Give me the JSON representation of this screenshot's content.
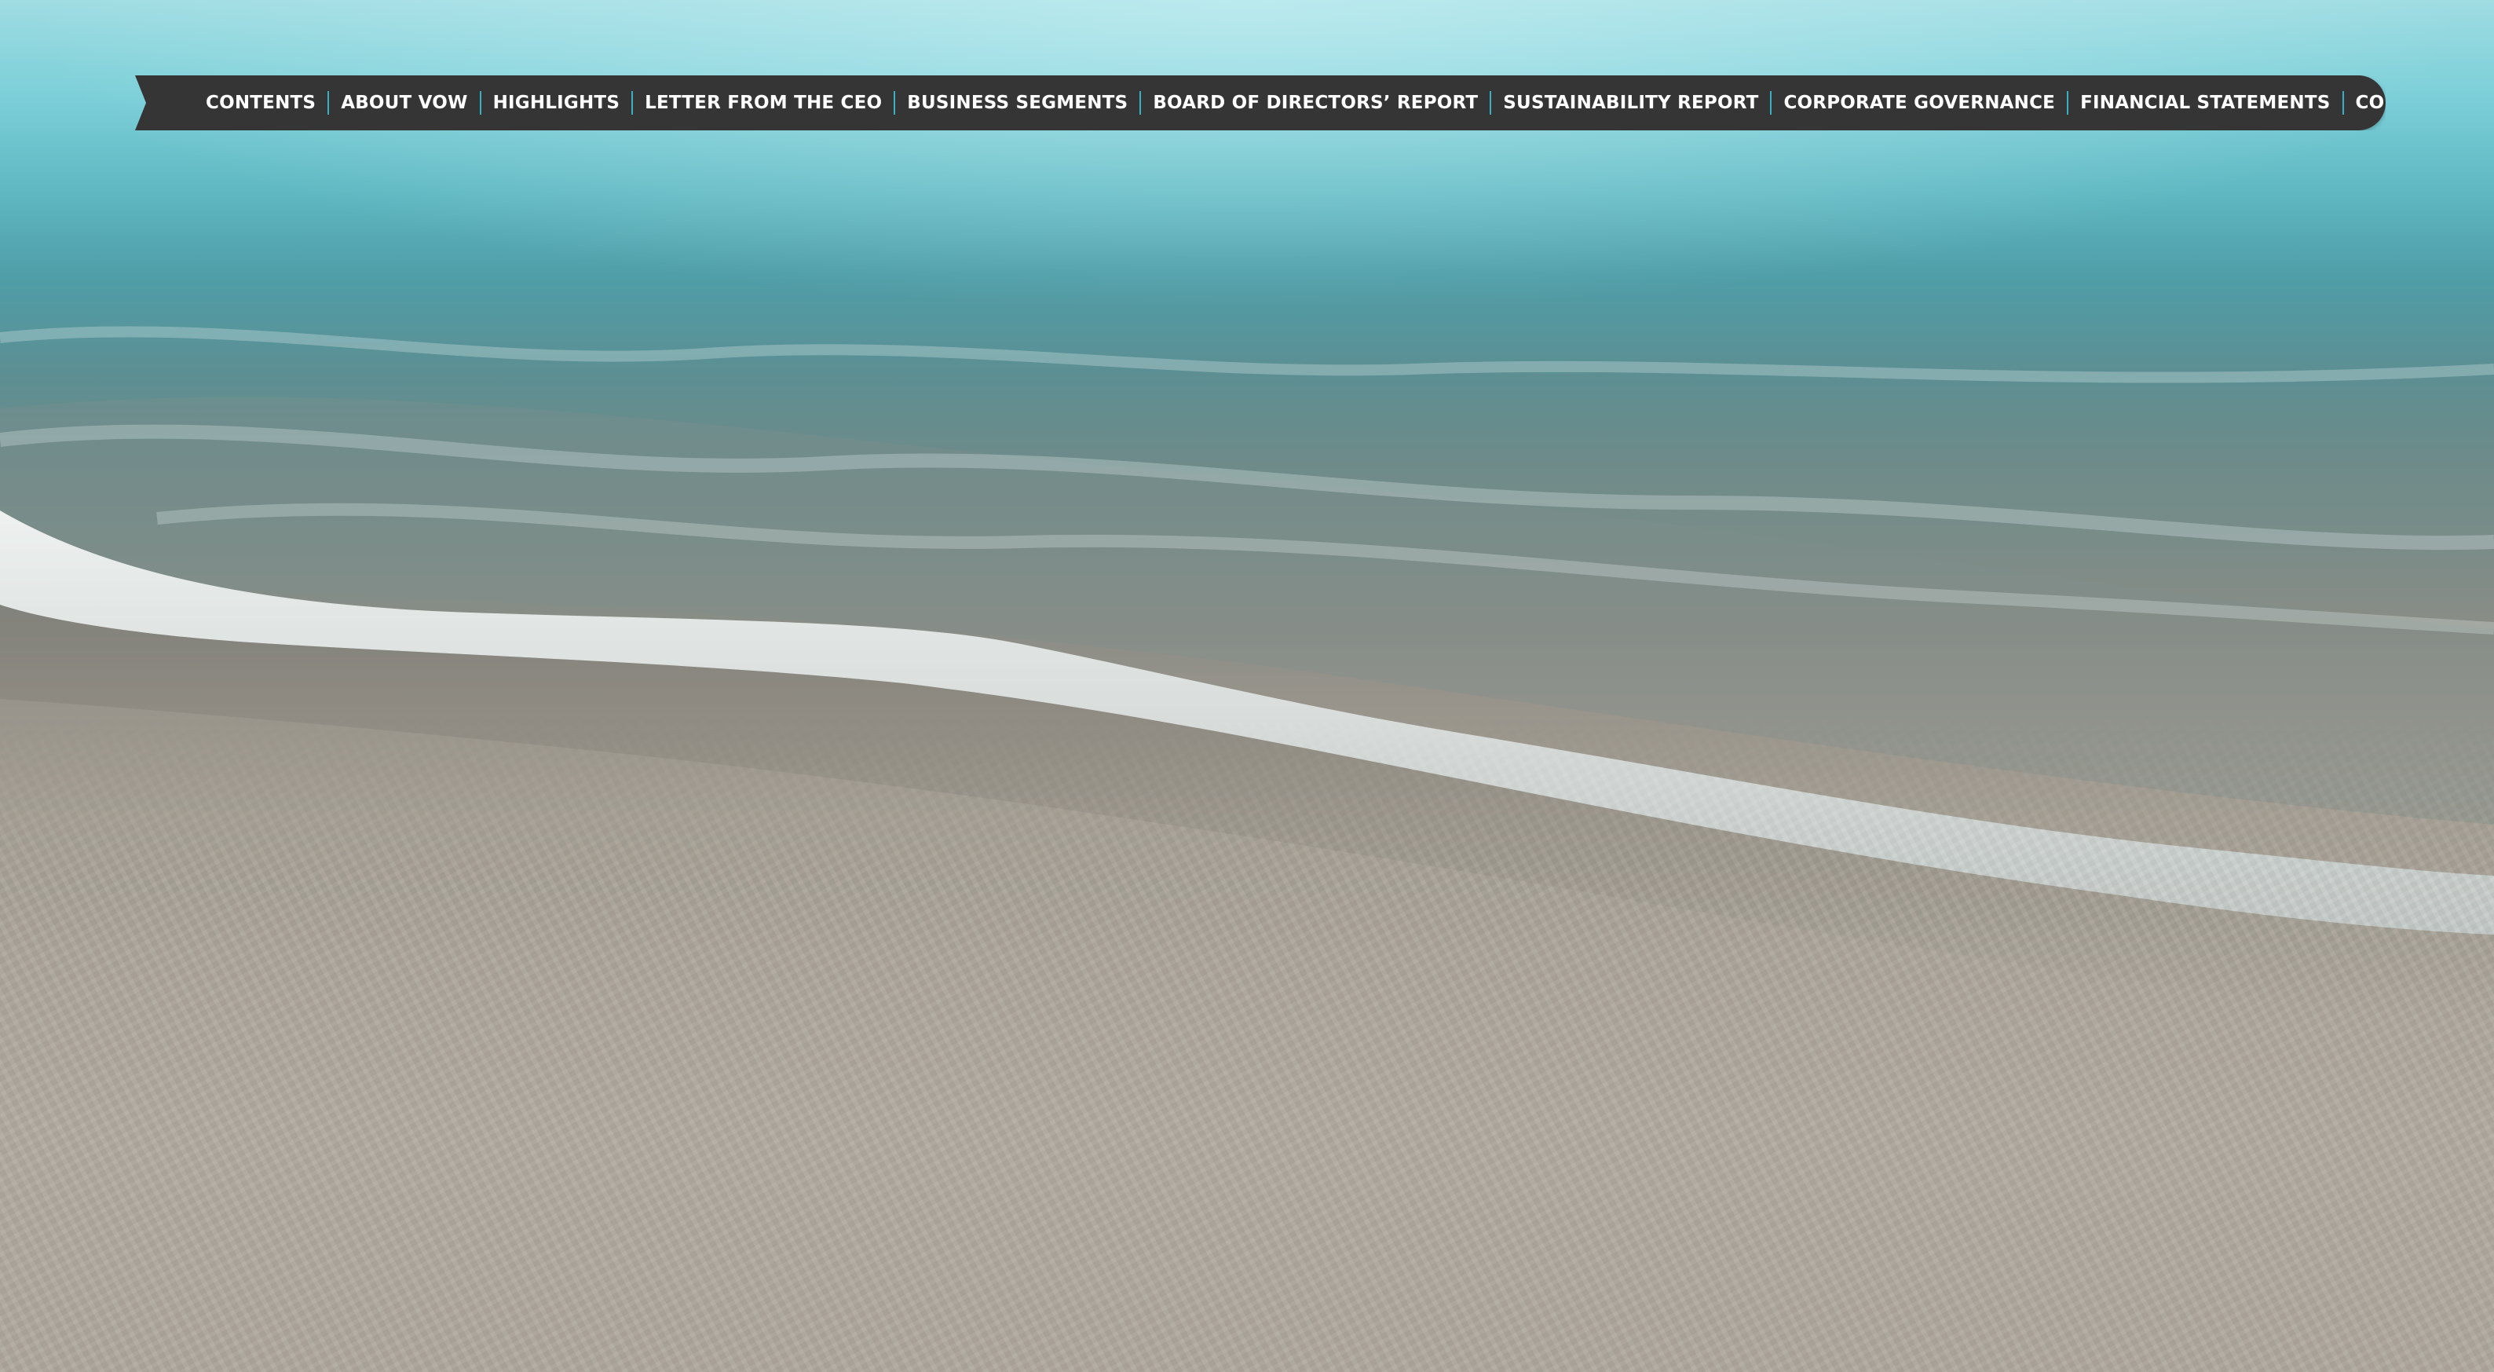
{
  "nav": {
    "items": [
      {
        "label": "CONTENTS"
      },
      {
        "label": "ABOUT VOW"
      },
      {
        "label": "HIGHLIGHTS"
      },
      {
        "label": "LETTER FROM THE CEO"
      },
      {
        "label": "BUSINESS SEGMENTS"
      },
      {
        "label": "BOARD OF DIRECTORS’ REPORT"
      },
      {
        "label": "SUSTAINABILITY REPORT"
      },
      {
        "label": "CORPORATE GOVERNANCE"
      },
      {
        "label": "FINANCIAL STATEMENTS"
      },
      {
        "label": "CONTACT"
      }
    ]
  },
  "colors": {
    "nav_background": "#363535",
    "nav_text": "#ffffff",
    "separator": "#3ab0c2"
  },
  "hero": {
    "image": "beach-wave-photo"
  }
}
